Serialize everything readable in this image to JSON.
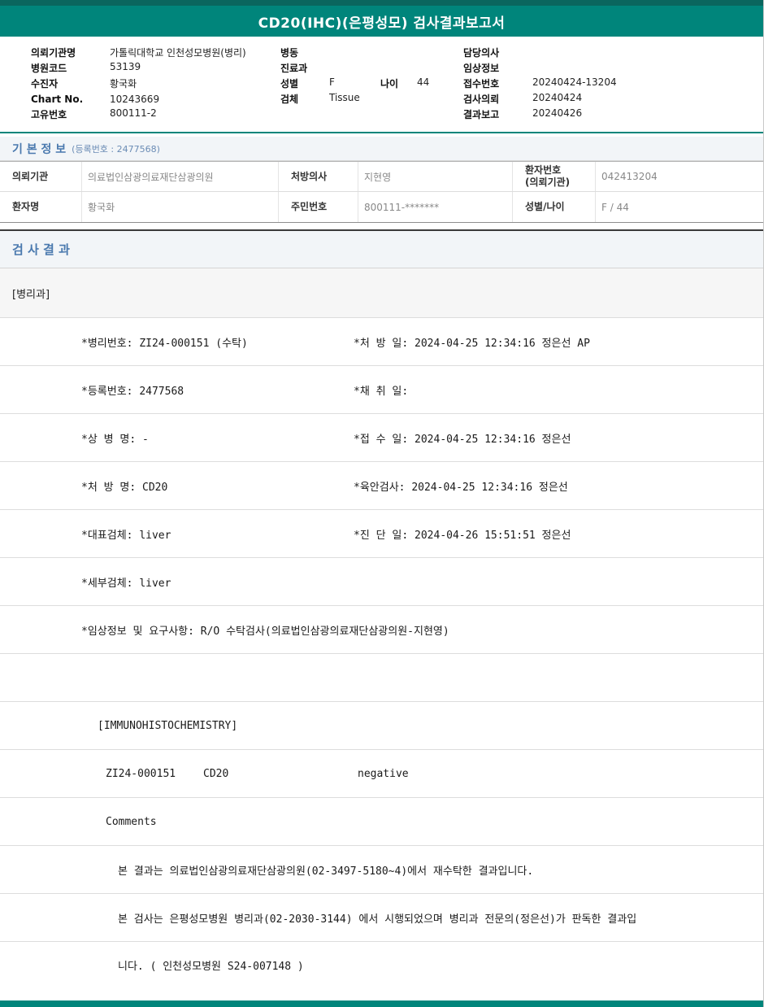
{
  "report": {
    "title": "CD20(IHC)(은평성모) 검사결과보고서"
  },
  "colors": {
    "teal": "#00857b",
    "teal_dark": "#0a665e",
    "section_blue": "#4a79ae"
  },
  "patient_header": {
    "rows": [
      {
        "c1_label": "의뢰기관명",
        "c1_value": "가톨릭대학교 인천성모병원(병리)",
        "c2_label": "병동",
        "c2_value": "",
        "c3_label": "담당의사",
        "c3_value": ""
      },
      {
        "c1_label": "병원코드",
        "c1_value": "53139",
        "c2_label": "진료과",
        "c2_value": "",
        "c3_label": "임상정보",
        "c3_value": ""
      },
      {
        "c1_label": "수진자",
        "c1_value": "황국화",
        "c2_label": "성별",
        "c2_value": "F",
        "c2b_label": "나이",
        "c2b_value": "44",
        "c3_label": "접수번호",
        "c3_value": "20240424-13204"
      },
      {
        "c1_label": "Chart No.",
        "c1_value": "10243669",
        "c2_label": "검체",
        "c2_value": "Tissue",
        "c3_label": "검사의뢰",
        "c3_value": "20240424"
      },
      {
        "c1_label": "고유번호",
        "c1_value": "800111-2",
        "c2_label": "",
        "c2_value": "",
        "c3_label": "결과보고",
        "c3_value": "20240426"
      }
    ]
  },
  "basic_info": {
    "title": "기 본 정 보",
    "reg_note": "(등록번호 : 2477568)",
    "row1": {
      "l1": "의뢰기관",
      "v1": "의료법인삼광의료재단삼광의원",
      "l2": "처방의사",
      "v2": "지현영",
      "l3": "환자번호\n(의뢰기관)",
      "v3": "042413204"
    },
    "row2": {
      "l1": "환자명",
      "v1": "황국화",
      "l2": "주민번호",
      "v2": "800111-*******",
      "l3": "성별/나이",
      "v3": "F / 44"
    }
  },
  "results": {
    "section_title": "검 사 결 과",
    "department": "[병리과]",
    "pairs": [
      {
        "left": "*병리번호: ZI24-000151 (수탁)",
        "right": "*처 방 일: 2024-04-25 12:34:16  정은선 AP"
      },
      {
        "left": "*등록번호: 2477568",
        "right": "*채 취 일:"
      },
      {
        "left": "*상 병 명: -",
        "right": "*접 수 일: 2024-04-25 12:34:16  정은선"
      },
      {
        "left": "*처 방 명: CD20",
        "right": "*육안검사: 2024-04-25 12:34:16   정은선"
      },
      {
        "left": "*대표검체: liver",
        "right": "*진 단 일: 2024-04-26 15:51:51   정은선"
      }
    ],
    "detail_specimen": "*세부검체: liver",
    "clinical_info": "*임상정보 및 요구사항: R/O 수탁검사(의료법인삼광의료재단삼광의원-지현영)",
    "ihc_header": "[IMMUNOHISTOCHEMISTRY]",
    "ihc_result": {
      "specimen_no": "ZI24-000151",
      "test": "CD20",
      "result": "negative"
    },
    "comments_label": "Comments",
    "comment_lines": [
      "본 결과는 의료법인삼광의료재단삼광의원(02-3497-5180~4)에서 재수탁한 결과입니다.",
      "본 검사는 은평성모병원 병리과(02-2030-3144) 에서 시행되었으며 병리과 전문의(정은선)가 판독한 결과입",
      "니다. ( 인천성모병원 S24-007148 )"
    ]
  }
}
